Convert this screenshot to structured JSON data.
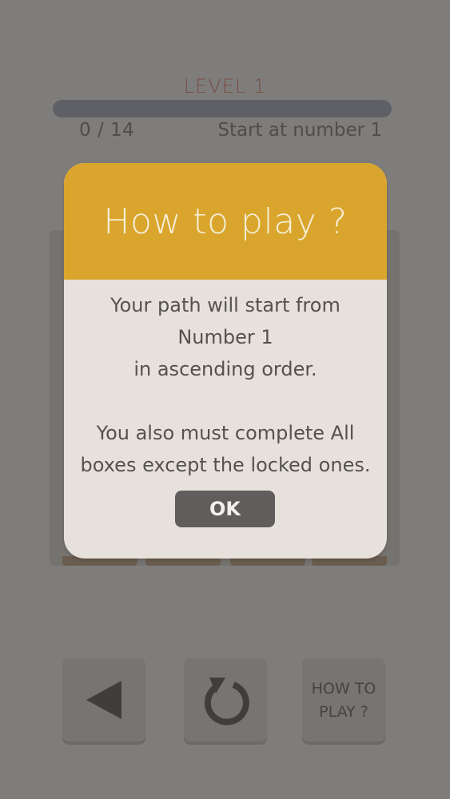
{
  "header": {
    "level_title": "LEVEL 1",
    "progress_fraction": 0,
    "counter": "0 / 14",
    "hint": "Start at number 1"
  },
  "dialog": {
    "title": "How to play ?",
    "body_lines_1": [
      "Your path will start from",
      "Number 1",
      "in ascending order."
    ],
    "body_lines_2": [
      "You also must complete All",
      "boxes except the locked ones."
    ],
    "ok_label": "OK"
  },
  "controls": {
    "back_icon": "triangle-left-icon",
    "undo_icon": "undo-arrow-icon",
    "help_label_line1": "HOW TO",
    "help_label_line2": "PLAY ?"
  },
  "colors": {
    "background": "#7f7d7b",
    "accent": "#d9a52c",
    "dialog_bg": "#e7e1dc",
    "level_title": "#7a4d45",
    "button_dark": "#5f5e5c"
  }
}
